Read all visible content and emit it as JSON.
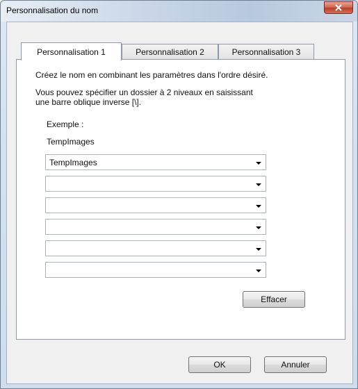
{
  "window": {
    "title": "Personnalisation du nom"
  },
  "tabs": [
    {
      "label": "Personnalisation 1",
      "active": true
    },
    {
      "label": "Personnalisation 2",
      "active": false
    },
    {
      "label": "Personnalisation 3",
      "active": false
    }
  ],
  "panel": {
    "instruction": "Créez le nom en combinant les paramètres dans l'ordre désiré.",
    "hint_line1": "Vous pouvez spécifier un dossier à 2 niveaux en saisissant",
    "hint_line2": "une barre oblique inverse [\\].",
    "example_label": "Exemple :",
    "example_value": "TempImages",
    "combos": [
      "TempImages",
      "",
      "",
      "",
      "",
      ""
    ],
    "clear_label": "Effacer"
  },
  "footer": {
    "ok_label": "OK",
    "cancel_label": "Annuler"
  }
}
